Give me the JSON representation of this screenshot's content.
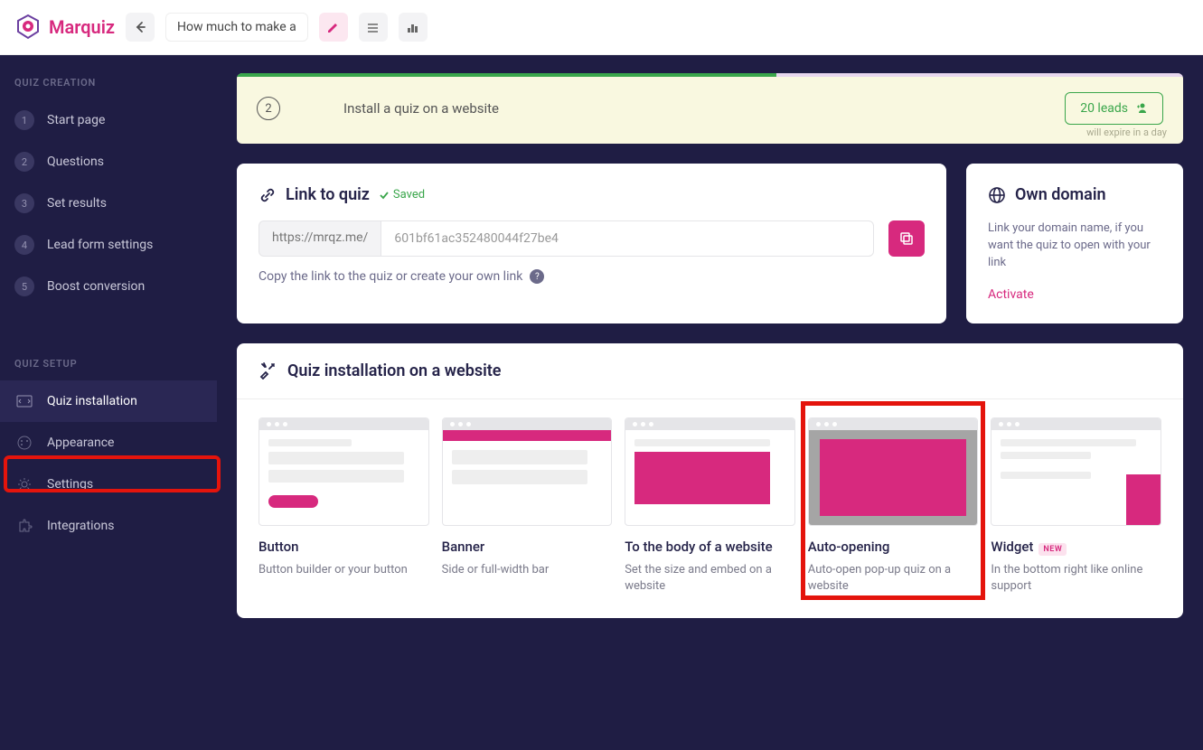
{
  "brand": "Marquiz",
  "quiz_name": "How much to make a",
  "sidebar": {
    "section1_title": "QUIZ CREATION",
    "section2_title": "QUIZ SETUP",
    "creation_items": [
      {
        "num": "1",
        "label": "Start page"
      },
      {
        "num": "2",
        "label": "Questions"
      },
      {
        "num": "3",
        "label": "Set results"
      },
      {
        "num": "4",
        "label": "Lead form settings"
      },
      {
        "num": "5",
        "label": "Boost conversion"
      }
    ],
    "setup_items": [
      {
        "label": "Quiz installation"
      },
      {
        "label": "Appearance"
      },
      {
        "label": "Settings"
      },
      {
        "label": "Integrations"
      }
    ]
  },
  "notice": {
    "step": "2",
    "text": "Install a quiz on a website",
    "leads_label": "20 leads",
    "expire": "will expire in a day"
  },
  "link_card": {
    "title": "Link to quiz",
    "saved": "Saved",
    "prefix": "https://mrqz.me/",
    "value": "601bf61ac352480044f27be4",
    "help": "Copy the link to the quiz or create your own link"
  },
  "domain_card": {
    "title": "Own domain",
    "text": "Link your domain name, if you want the quiz to open with your link",
    "activate": "Activate"
  },
  "install": {
    "title": "Quiz installation on a website",
    "items": [
      {
        "title": "Button",
        "desc": "Button builder or your button"
      },
      {
        "title": "Banner",
        "desc": "Side or full-width bar"
      },
      {
        "title": "To the body of a website",
        "desc": "Set the size and embed on a website"
      },
      {
        "title": "Auto-opening",
        "desc": "Auto-open pop-up quiz on a website"
      },
      {
        "title": "Widget",
        "desc": "In the bottom right like online support"
      }
    ],
    "new_badge": "NEW"
  }
}
